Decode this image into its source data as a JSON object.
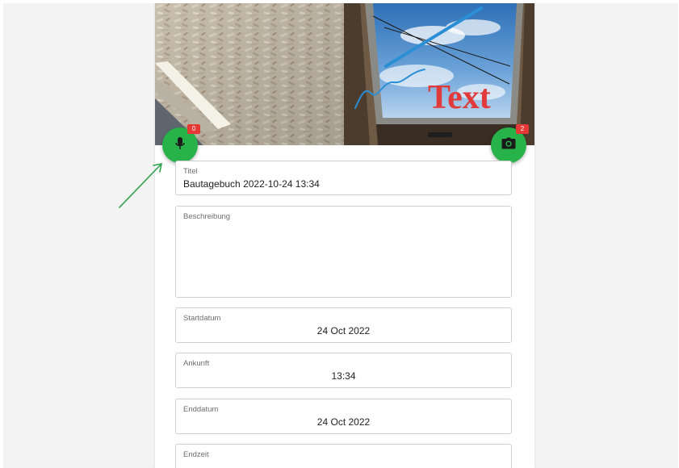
{
  "colors": {
    "fab_green": "#28b34a",
    "badge_red": "#e53935",
    "arrow_green": "#2ca24a",
    "annotation_red": "#e03a3a",
    "annotation_blue": "#2b8fd6"
  },
  "photos": {
    "left": {
      "icon": "ceiling-photo"
    },
    "right": {
      "icon": "skylight-photo",
      "annotation_text": "Text"
    }
  },
  "audio_button": {
    "icon": "microphone-icon",
    "badge": "0"
  },
  "camera_button": {
    "icon": "camera-icon",
    "badge": "2"
  },
  "form": {
    "title": {
      "label": "Titel",
      "value": "Bautagebuch 2022-10-24 13:34"
    },
    "description": {
      "label": "Beschreibung",
      "value": ""
    },
    "start_date": {
      "label": "Startdatum",
      "value": "24 Oct 2022"
    },
    "arrival": {
      "label": "Ankunft",
      "value": "13:34"
    },
    "end_date": {
      "label": "Enddatum",
      "value": "24 Oct 2022"
    },
    "end_time": {
      "label": "Endzeit",
      "value": ""
    }
  }
}
